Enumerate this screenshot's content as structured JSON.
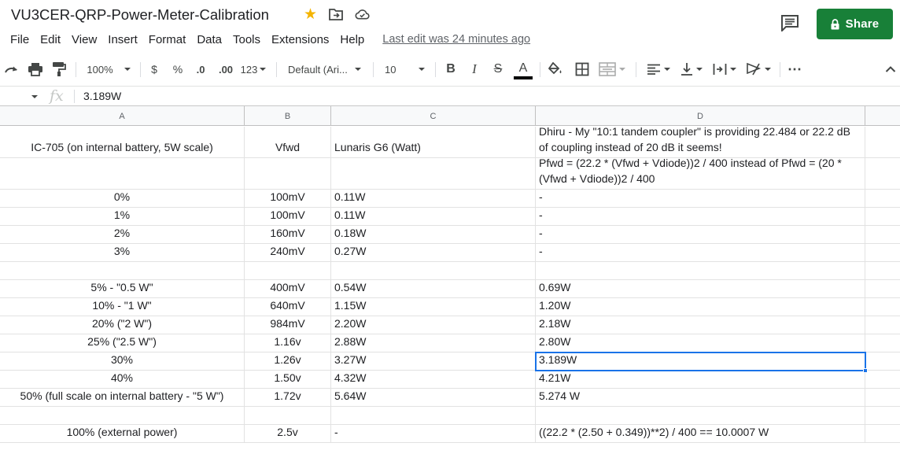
{
  "app": {
    "doc_title": "VU3CER-QRP-Power-Meter-Calibration",
    "share_label": "Share",
    "last_edit": "Last edit was 24 minutes ago"
  },
  "menu": [
    "File",
    "Edit",
    "View",
    "Insert",
    "Format",
    "Data",
    "Tools",
    "Extensions",
    "Help"
  ],
  "toolbar": {
    "zoom": "100%",
    "currency": "$",
    "percent": "%",
    "decrease_decimal": ".0",
    "increase_decimal": ".00",
    "more_formats": "123",
    "font": "Default (Ari...",
    "font_size": "10",
    "bold": "B",
    "italic": "I",
    "strikethrough": "S",
    "text_color": "A",
    "more": "⋯"
  },
  "formula_bar": {
    "value": "3.189W"
  },
  "columns": [
    "A",
    "B",
    "C",
    "D"
  ],
  "rows": [
    {
      "a": "IC-705 (on internal battery, 5W scale)",
      "b": "Vfwd",
      "c": "Lunaris G6 (Watt)",
      "d": "Dhiru - My \"10:1 tandem coupler\" is providing 22.484 or 22.2 dB of coupling instead of 20 dB it seems!"
    },
    {
      "a": "",
      "b": "",
      "c": "",
      "d": "Pfwd = (22.2 * (Vfwd + Vdiode))2 / 400 instead of Pfwd = (20 * (Vfwd + Vdiode))2 / 400"
    },
    {
      "a": "0%",
      "b": "100mV",
      "c": "0.11W",
      "d": "-"
    },
    {
      "a": "1%",
      "b": "100mV",
      "c": "0.11W",
      "d": "-"
    },
    {
      "a": "2%",
      "b": "160mV",
      "c": "0.18W",
      "d": "-"
    },
    {
      "a": "3%",
      "b": "240mV",
      "c": "0.27W",
      "d": "-"
    },
    {
      "a": "",
      "b": "",
      "c": "",
      "d": ""
    },
    {
      "a": "5% - \"0.5 W\"",
      "b": "400mV",
      "c": "0.54W",
      "d": "0.69W"
    },
    {
      "a": "10% - \"1 W\"",
      "b": "640mV",
      "c": "1.15W",
      "d": "1.20W"
    },
    {
      "a": "20% (\"2 W\")",
      "b": "984mV",
      "c": "2.20W",
      "d": "2.18W"
    },
    {
      "a": "25% (\"2.5 W\")",
      "b": "1.16v",
      "c": "2.88W",
      "d": "2.80W"
    },
    {
      "a": "30%",
      "b": "1.26v",
      "c": "3.27W",
      "d": "3.189W"
    },
    {
      "a": "40%",
      "b": "1.50v",
      "c": "4.32W",
      "d": "4.21W"
    },
    {
      "a": "50% (full scale on internal battery - \"5 W\")",
      "b": "1.72v",
      "c": "5.64W",
      "d": "5.274 W"
    },
    {
      "a": "",
      "b": "",
      "c": "",
      "d": ""
    },
    {
      "a": "100% (external power)",
      "b": "2.5v",
      "c": "-",
      "d": "((22.2 * (2.50 + 0.349))**2) / 400 == 10.0007 W"
    }
  ],
  "colors": {
    "accent": "#1a73e8",
    "share": "#188038",
    "star": "#f4b400"
  }
}
